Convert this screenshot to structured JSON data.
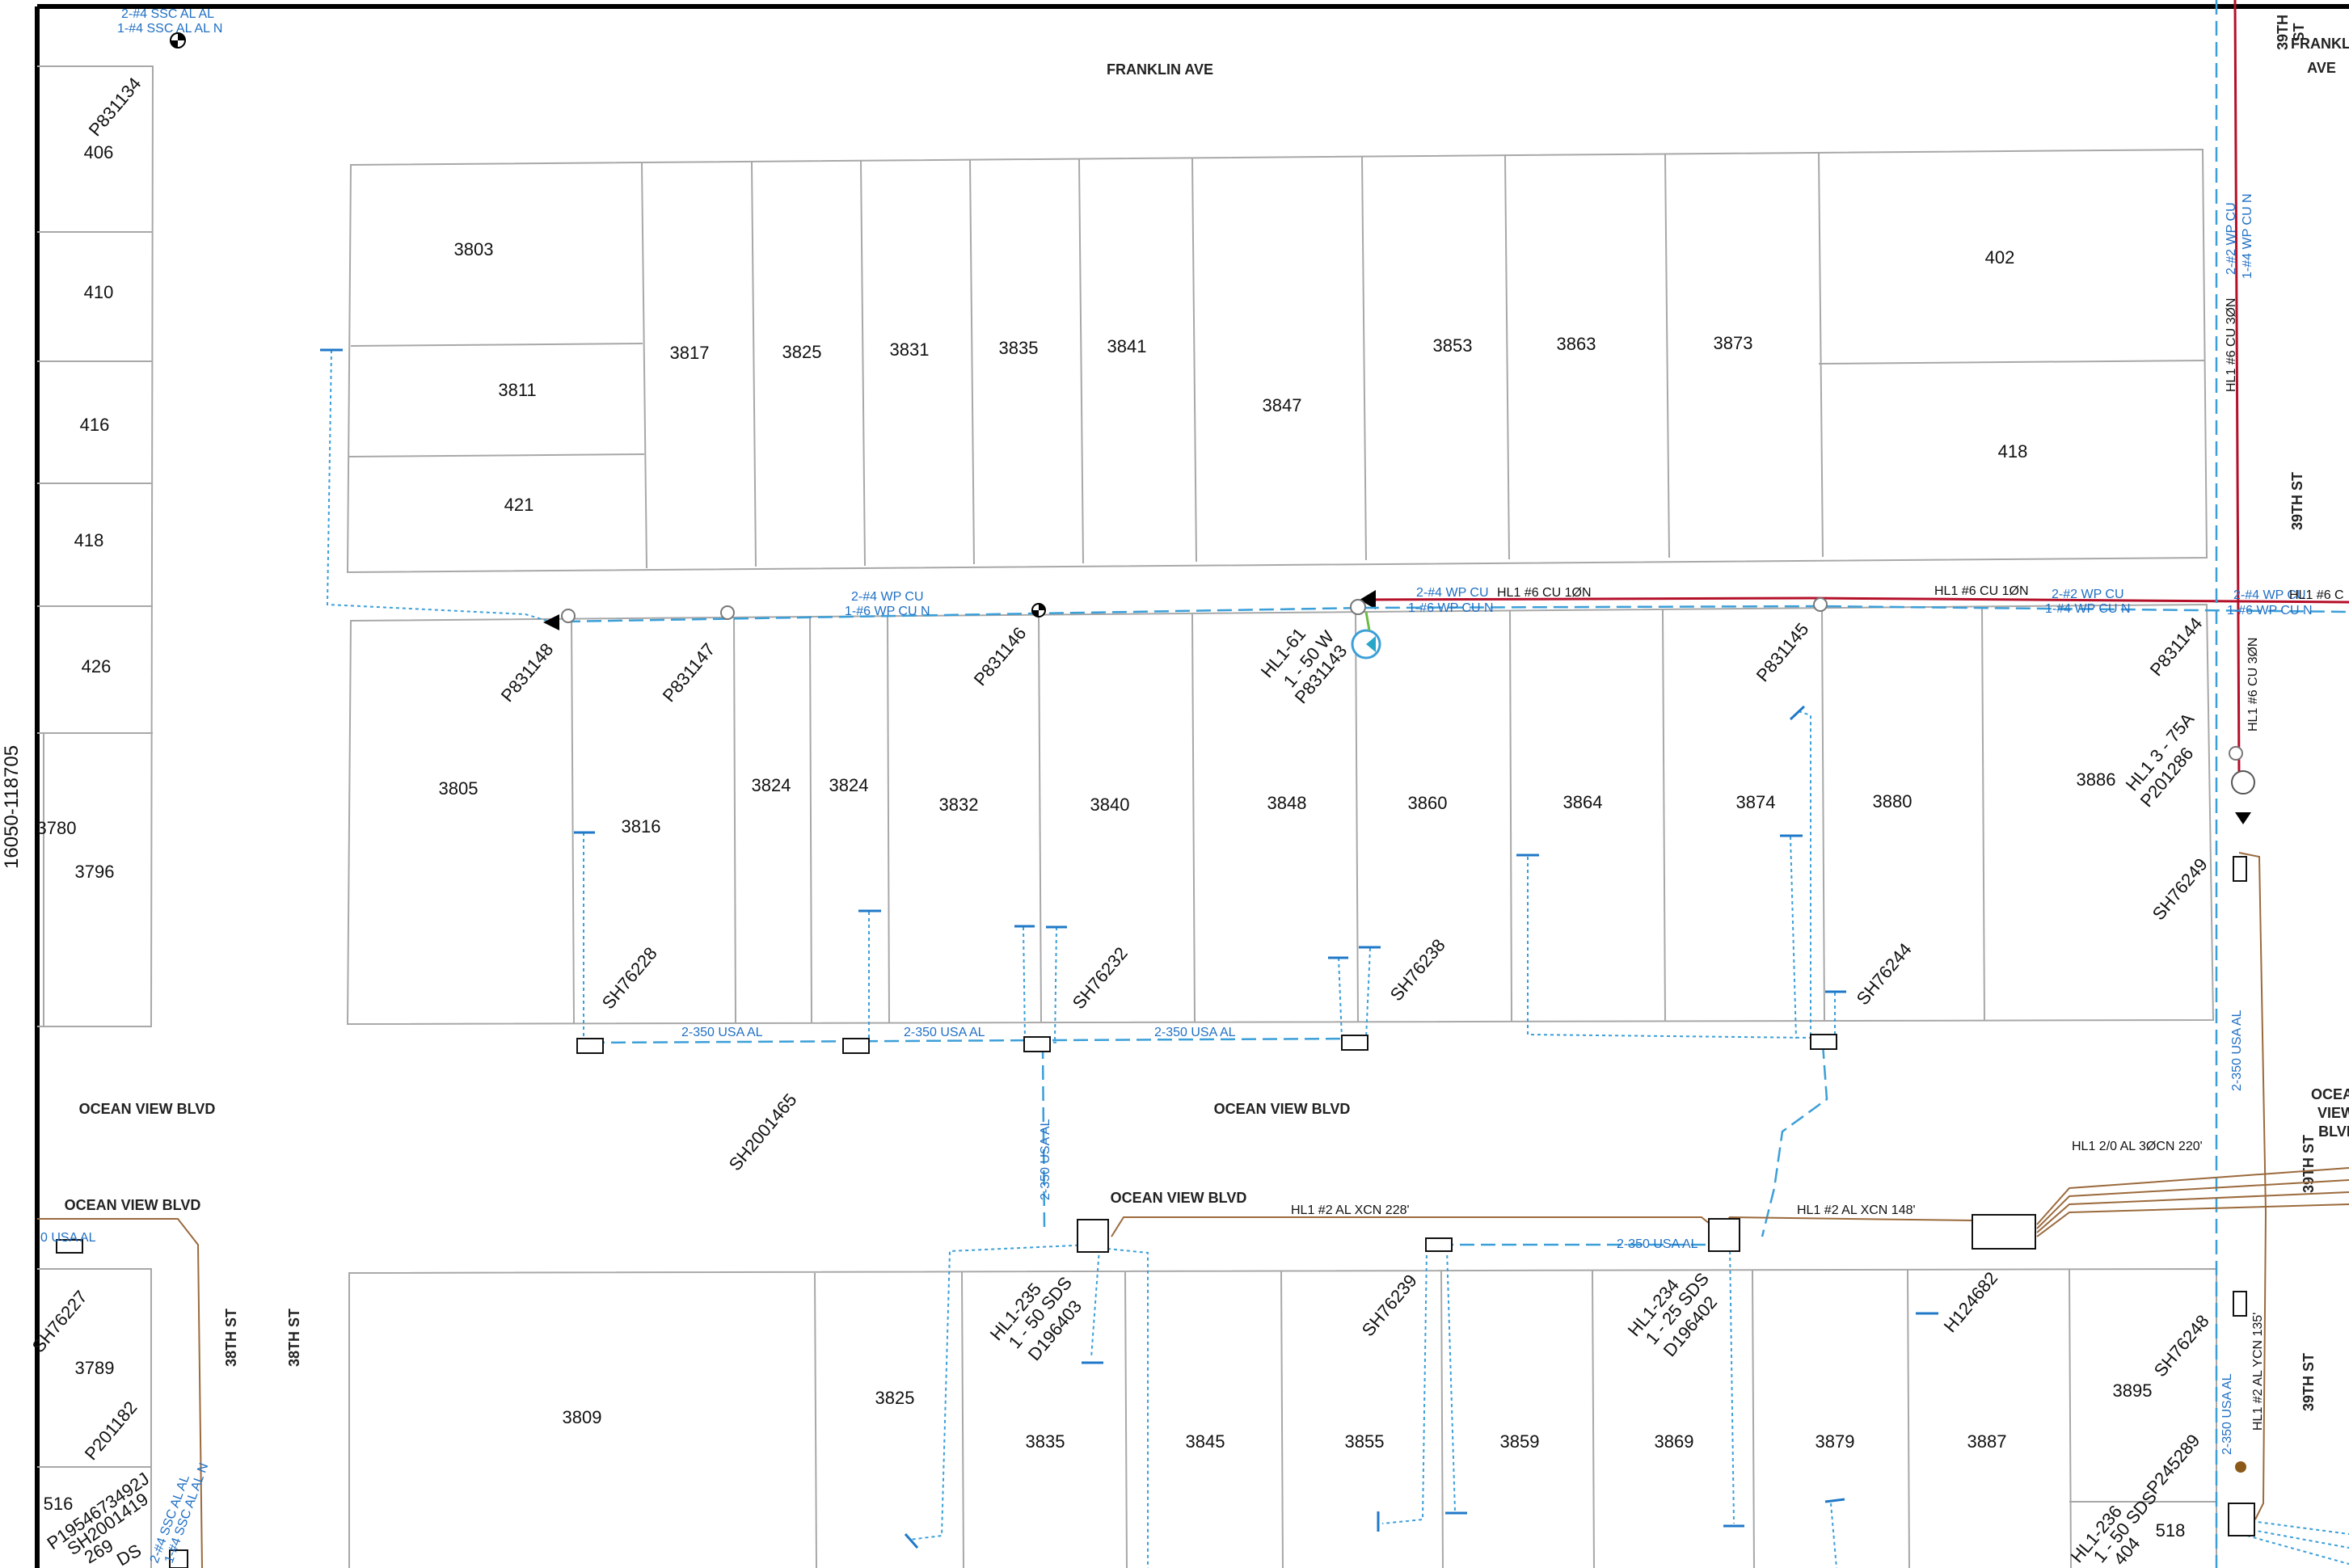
{
  "streets": {
    "franklin_ave": "FRANKLIN AVE",
    "franklin_ave_right_1": "39TH",
    "franklin_ave_right_2": "ST",
    "franklin_ave_right_3": "FRANKLIN",
    "franklin_ave_right_4": "AVE",
    "ocean_view_left": "OCEAN VIEW BLVD",
    "ocean_view_left_2": "OCEAN VIEW BLVD",
    "ocean_view_mid": "OCEAN VIEW BLVD",
    "ocean_view_lower": "OCEAN VIEW BLVD",
    "ocean_view_right_1": "OCEA",
    "ocean_view_right_2": "VIEW",
    "ocean_view_right_3": "BLVD",
    "st38_a": "38TH ST",
    "st38_b": "38TH ST",
    "st39_a": "39TH ST",
    "st39_b": "39TH ST",
    "st39_c": "39TH ST"
  },
  "map_sheet_id": "16050-118705",
  "top_block_lots": [
    "3803",
    "3811",
    "421",
    "3817",
    "3825",
    "3831",
    "3835",
    "3841",
    "3847",
    "3853",
    "3863",
    "3873",
    "402",
    "418"
  ],
  "left_block_lots": [
    "406",
    "410",
    "416",
    "418",
    "426",
    "3780",
    "3796"
  ],
  "middle_block_lots": [
    "3805",
    "3816",
    "3824",
    "3824",
    "3832",
    "3840",
    "3848",
    "3860",
    "3864",
    "3874",
    "3880",
    "3886"
  ],
  "bottom_block_lots": [
    "3809",
    "3825",
    "3835",
    "3845",
    "3855",
    "3859",
    "3869",
    "3879",
    "3887",
    "3895",
    "518",
    "3789",
    "516"
  ],
  "poles": [
    "P831134",
    "P831148",
    "P831147",
    "P831146",
    "P831145",
    "P831144",
    "P201182"
  ],
  "service_points": [
    "SH76228",
    "SH76232",
    "SH76238",
    "SH76244",
    "SH76249",
    "SH2001465",
    "SH76239",
    "SH76248",
    "H124682",
    "P245289",
    "SH76227"
  ],
  "light": {
    "hl161_a": "HL1-61",
    "hl161_b": "1 - 50 W",
    "hl161_c": "P831143",
    "hl13_a": "HL1 3 - 75A",
    "hl13_b": "P201286"
  },
  "streetlights": {
    "hl1235_a": "HL1-235",
    "hl1235_b": "1 - 50 SDS",
    "hl1235_c": "D196403",
    "hl1234_a": "HL1-234",
    "hl1234_b": "1 - 25 SDS",
    "hl1234_c": "D196402",
    "hl1236_a": "HL1-236",
    "hl1236_b": "1 - 50 SDS",
    "hl1236_c": "404"
  },
  "wires": {
    "ssc_top_1": "2-#4 SSC AL AL",
    "ssc_top_2": "1-#4 SSC AL AL N",
    "wp_a1": "2-#4 WP CU",
    "wp_a2": "1-#6 WP CU N",
    "wp_b1": "2-#4 WP CU",
    "wp_b2": "1-#6 WP CU N",
    "hl1_cu_a": "HL1 #6 CU 1ØN",
    "hl1_cu_b": "HL1 #6 CU 1ØN",
    "wp_c1": "2-#2 WP CU",
    "wp_c2": "1-#4 WP CU N",
    "wp_d1": "2-#4 WP CU",
    "wp_d2": "1-#6 WP CU N",
    "hl1_c": "HL1 #6 C",
    "vert_wp_1": "2-#2 WP CU",
    "vert_wp_2": "1-#4 WP CU N",
    "vert_hl1": "HL1 #6 CU 3ØN",
    "vert_hl1_b": "HL1 #6 CU 3ØN",
    "usa_1": "2-350 USA AL",
    "usa_2": "2-350 USA AL",
    "usa_3": "2-350 USA AL",
    "usa_4": "2-350 USA AL",
    "usa_5": "2-350 USA AL",
    "usa_6": "2-350 USA AL",
    "usa_7": "2-350 USA AL",
    "usa_left": "0 USA AL",
    "xcn_228": "HL1 #2 AL XCN 228'",
    "xcn_148": "HL1 #2 AL XCN 148'",
    "hl1_20": "HL1 2/0 AL 3ØCN 220'",
    "ycn_135": "HL1 #2 AL YCN 135'",
    "ssc_bl_1": "2-#4 SSC AL AL",
    "ssc_bl_2": "1-#4 SSC AL AL N",
    "sh2001419": "SH2001419",
    "p1954": "P1954673492J",
    "bl_269": "269",
    "bl_ds": "DS"
  },
  "colors": {
    "primary_line": "#b5102a",
    "service_line": "#3b9fd8",
    "label_blue": "#1f6fc4",
    "cable_brown": "#9b6a3c"
  }
}
